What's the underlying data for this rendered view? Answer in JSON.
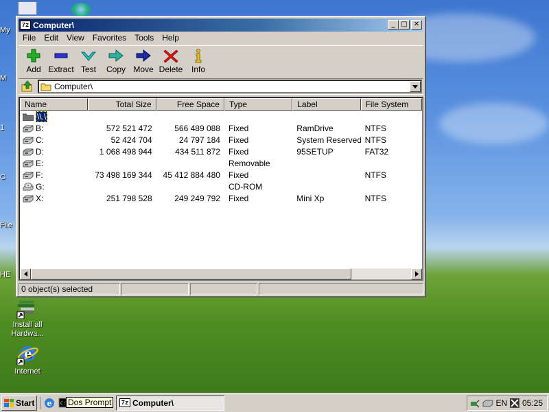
{
  "window": {
    "title": "Computer\\",
    "app_badge": "7z",
    "buttons": {
      "minimize": "_",
      "maximize": "□",
      "close": "✕"
    }
  },
  "menu": [
    "File",
    "Edit",
    "View",
    "Favorites",
    "Tools",
    "Help"
  ],
  "toolbar": [
    {
      "label": "Add",
      "icon": "add-icon"
    },
    {
      "label": "Extract",
      "icon": "extract-icon"
    },
    {
      "label": "Test",
      "icon": "test-icon"
    },
    {
      "label": "Copy",
      "icon": "copy-icon"
    },
    {
      "label": "Move",
      "icon": "move-icon"
    },
    {
      "label": "Delete",
      "icon": "delete-icon"
    },
    {
      "label": "Info",
      "icon": "info-icon"
    }
  ],
  "address": {
    "path": "Computer\\"
  },
  "columns": [
    "Name",
    "Total Size",
    "Free Space",
    "Type",
    "Label",
    "File System"
  ],
  "rows": [
    {
      "name": "\\\\.\\",
      "total": "",
      "free": "",
      "type": "",
      "label": "",
      "fs": "",
      "icon": "folder",
      "selected": true
    },
    {
      "name": "B:",
      "total": "572 521 472",
      "free": "566 489 088",
      "type": "Fixed",
      "label": "RamDrive",
      "fs": "NTFS",
      "icon": "drive"
    },
    {
      "name": "C:",
      "total": "52 424 704",
      "free": "24 797 184",
      "type": "Fixed",
      "label": "System Reserved",
      "fs": "NTFS",
      "icon": "drive"
    },
    {
      "name": "D:",
      "total": "1 068 498 944",
      "free": "434 511 872",
      "type": "Fixed",
      "label": "95SETUP",
      "fs": "FAT32",
      "icon": "drive"
    },
    {
      "name": "E:",
      "total": "",
      "free": "",
      "type": "Removable",
      "label": "",
      "fs": "",
      "icon": "drive"
    },
    {
      "name": "F:",
      "total": "73 498 169 344",
      "free": "45 412 884 480",
      "type": "Fixed",
      "label": "",
      "fs": "NTFS",
      "icon": "drive"
    },
    {
      "name": "G:",
      "total": "",
      "free": "",
      "type": "CD-ROM",
      "label": "",
      "fs": "",
      "icon": "cdrom"
    },
    {
      "name": "X:",
      "total": "251 798 528",
      "free": "249 249 792",
      "type": "Fixed",
      "label": "Mini Xp",
      "fs": "NTFS",
      "icon": "drive"
    }
  ],
  "status": {
    "selected": "0 object(s) selected"
  },
  "desktop": {
    "icons": [
      {
        "label": "Install all Hardwa...",
        "icon": "hardware-install-icon"
      },
      {
        "label": "Internet",
        "icon": "internet-explorer-icon"
      }
    ],
    "edge_labels": [
      "My",
      "M",
      "1",
      "C",
      "File",
      "HE"
    ]
  },
  "taskbar": {
    "start": "Start",
    "tooltip": "Dos Prompt",
    "task": "Computer\\",
    "tray_lang": "EN",
    "clock": "05:25"
  }
}
